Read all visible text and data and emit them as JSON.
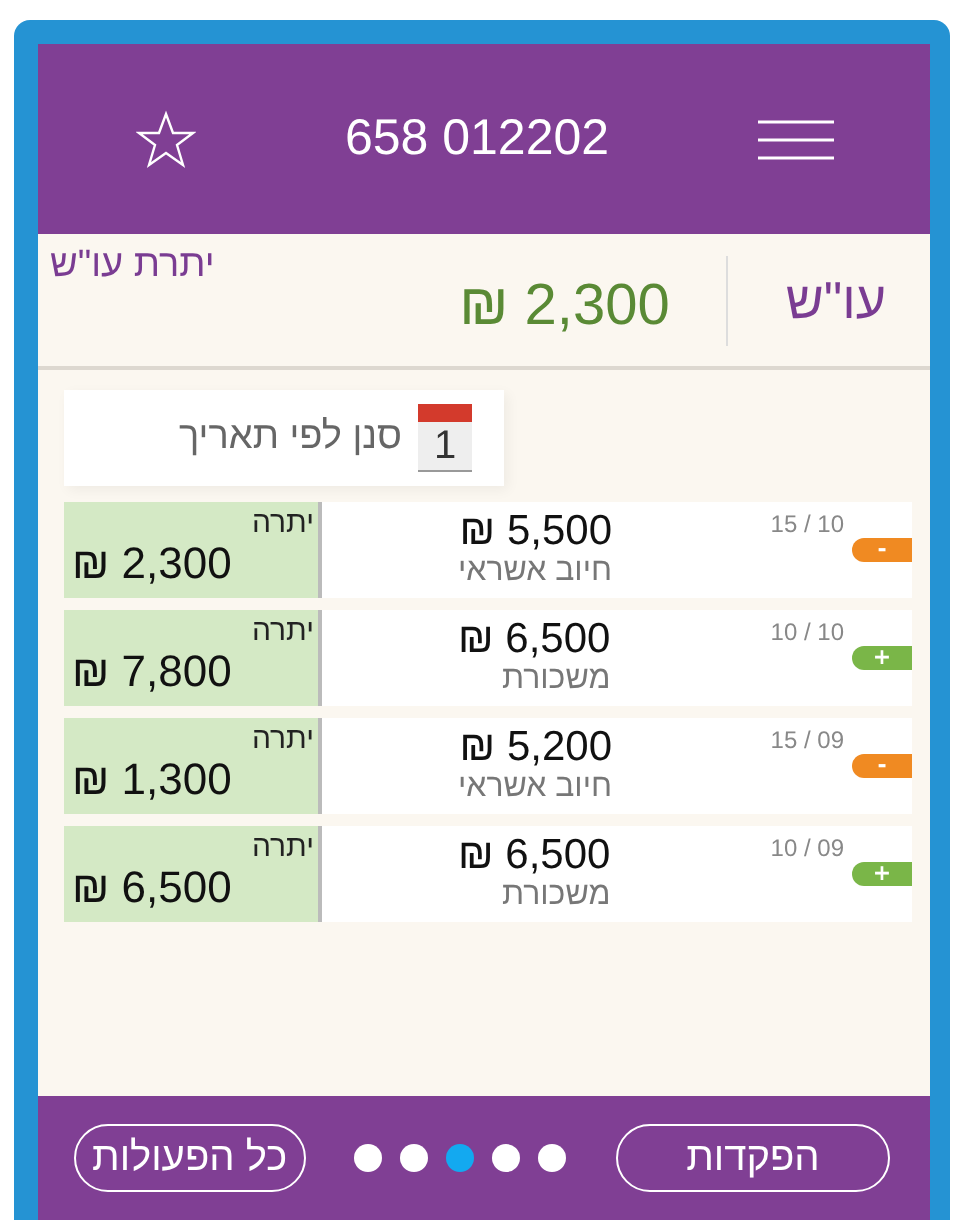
{
  "header": {
    "title": "658 012202"
  },
  "summary": {
    "label": "עו\"ש",
    "amount": "₪ 2,300",
    "caption": "יתרת עו\"ש"
  },
  "sort": {
    "label": "סנן לפי תאריך",
    "calendar_day": "1"
  },
  "transactions": [
    {
      "date": "15 / 10",
      "kind": "debit",
      "sign": "-",
      "amount": "₪ 5,500",
      "description": "חיוב אשראי",
      "balance_label": "יתרה",
      "balance": "₪ 2,300"
    },
    {
      "date": "10 / 10",
      "kind": "credit",
      "sign": "+",
      "amount": "₪ 6,500",
      "description": "משכורת",
      "balance_label": "יתרה",
      "balance": "₪ 7,800"
    },
    {
      "date": "15 / 09",
      "kind": "debit",
      "sign": "-",
      "amount": "₪ 5,200",
      "description": "חיוב אשראי",
      "balance_label": "יתרה",
      "balance": "₪ 1,300"
    },
    {
      "date": "10 / 09",
      "kind": "credit",
      "sign": "+",
      "amount": "₪ 6,500",
      "description": "משכורת",
      "balance_label": "יתרה",
      "balance": "₪ 6,500"
    }
  ],
  "footer": {
    "right_button": "הפקדות",
    "left_button": "כל הפעולות",
    "pages": [
      {
        "selected": false
      },
      {
        "selected": false
      },
      {
        "selected": true
      },
      {
        "selected": false
      },
      {
        "selected": false
      }
    ]
  }
}
